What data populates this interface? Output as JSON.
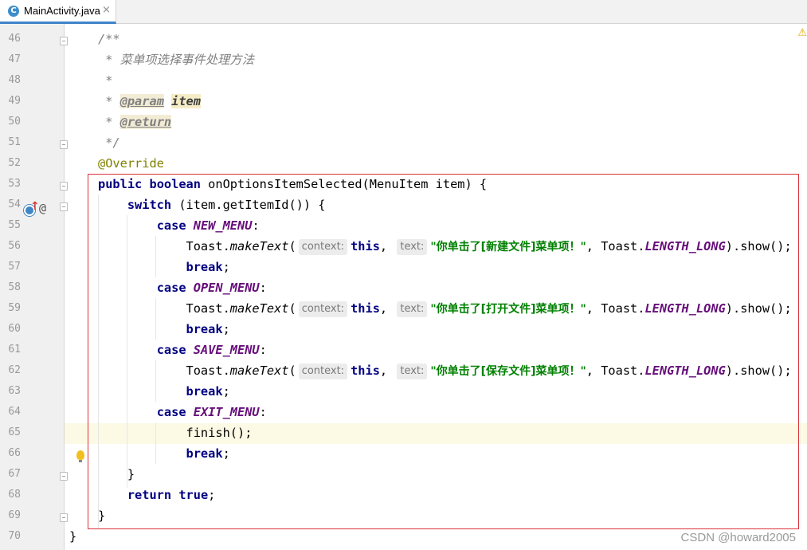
{
  "tab": {
    "title": "MainActivity.java",
    "icon_letter": "C",
    "close_glyph": "×"
  },
  "gutter": {
    "line_numbers": [
      "46",
      "47",
      "48",
      "49",
      "50",
      "51",
      "52",
      "53",
      "54",
      "55",
      "56",
      "57",
      "58",
      "59",
      "60",
      "61",
      "62",
      "63",
      "64",
      "65",
      "66",
      "67",
      "68",
      "69",
      "70"
    ]
  },
  "code": {
    "l46": "/**",
    "l47": " * 菜单项选择事件处理方法",
    "l48": " *",
    "l49_star": " * ",
    "l49_tag": "@param",
    "l49_val": "item",
    "l50_star": " * ",
    "l50_tag": "@return",
    "l51": " */",
    "l52": "@Override",
    "kw_public": "public",
    "kw_boolean": "boolean",
    "l53_rest": " onOptionsItemSelected(MenuItem item) {",
    "kw_switch": "switch",
    "l54_rest": " (item.getItemId()) {",
    "kw_case": "case",
    "kw_this": "this",
    "kw_break": "break",
    "kw_return": "return",
    "kw_true": "true",
    "toast": "Toast.",
    "make_text": "makeText",
    "hint_context": "context:",
    "hint_text": "text:",
    "length_long": "LENGTH_LONG",
    "show_tail": ").show();",
    "case1": "NEW_MENU",
    "case2": "OPEN_MENU",
    "case3": "SAVE_MENU",
    "case4": "EXIT_MENU",
    "str1": "\"你单击了[新建文件]菜单项！\"",
    "str2": "\"你单击了[打开文件]菜单项！\"",
    "str3": "\"你单击了[保存文件]菜单项！\"",
    "finish": "finish();",
    "close_brace": "}",
    "watermark": "CSDN @howard2005"
  },
  "icons": {
    "warning": "warning-icon",
    "bulb": "lightbulb-icon",
    "override": "override-icon",
    "annotation": "annotation-icon"
  },
  "colors": {
    "keyword": "#000080",
    "string": "#008000",
    "constant": "#660e7a",
    "annotation": "#808000",
    "highlight_box": "#d9323a"
  }
}
